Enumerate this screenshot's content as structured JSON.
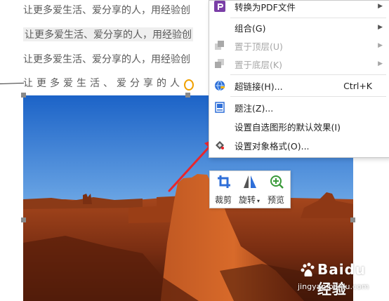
{
  "document": {
    "lines": [
      "让更多爱生活、爱分享的人，用经验创",
      "让更多爱生活、爱分享的人，用经验创",
      "让更多爱生活、爱分享的人，用经验创",
      "让更多爱生活、爱分享的人"
    ]
  },
  "context_menu": {
    "items": [
      {
        "icon": "pdf-icon",
        "label": "转换为PDF文件",
        "arrow": "▶",
        "enabled": true
      },
      {
        "icon": "",
        "label": "组合(G)",
        "arrow": "▶",
        "enabled": true
      },
      {
        "icon": "bring-to-front-icon",
        "label": "置于顶层(U)",
        "arrow": "▶",
        "enabled": false
      },
      {
        "icon": "send-to-back-icon",
        "label": "置于底层(K)",
        "arrow": "▶",
        "enabled": false
      },
      {
        "icon": "hyperlink-icon",
        "label": "超链接(H)...",
        "shortcut": "Ctrl+K",
        "enabled": true
      },
      {
        "icon": "caption-icon",
        "label": "题注(Z)...",
        "enabled": true
      },
      {
        "icon": "",
        "label": "设置自选图形的默认效果(I)",
        "enabled": true
      },
      {
        "icon": "format-object-icon",
        "label": "设置对象格式(O)...",
        "enabled": true
      }
    ]
  },
  "mini_toolbar": {
    "crop": "裁剪",
    "rotate": "旋转",
    "rotate_caret": "▾",
    "preview": "预览"
  },
  "watermark": {
    "brand": "Baidu 经验",
    "url": "jingyan.baidu.com"
  },
  "colors": {
    "annotation_arrow": "#e8262c",
    "icon_blue": "#2f6fd8",
    "pdf_purple": "#7b3fa7"
  }
}
